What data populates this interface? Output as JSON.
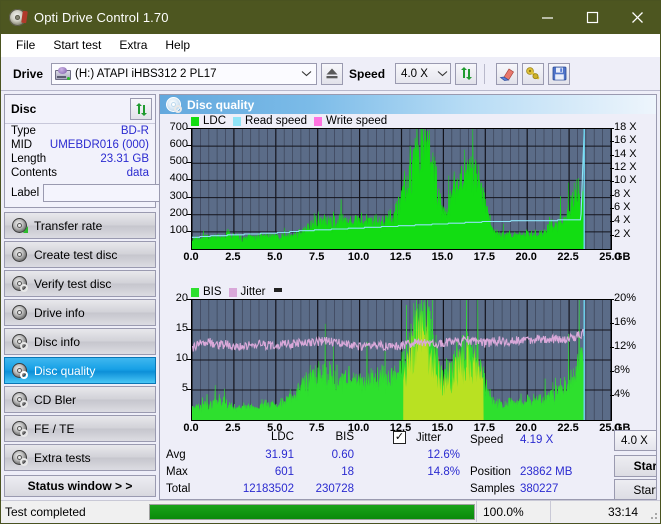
{
  "window": {
    "title": "Opti Drive Control 1.70",
    "icon": "disc-icon",
    "minimize": "minimize-icon",
    "maximize": "maximize-icon",
    "close": "close-icon"
  },
  "menu": {
    "items": [
      "File",
      "Start test",
      "Extra",
      "Help"
    ]
  },
  "toolbar": {
    "drive_label": "Drive",
    "drive_value": "(H:)   ATAPI iHBS312  2 PL17",
    "eject_icon": "eject-icon",
    "speed_label": "Speed",
    "speed_value": "4.0 X",
    "refresh_icon": "refresh-icon",
    "erase_icon": "eraser-icon",
    "bookmark_icon": "keys-icon",
    "save_icon": "floppy-save-icon"
  },
  "disc_panel": {
    "title": "Disc",
    "refresh_icon": "refresh-icon",
    "rows": [
      {
        "key": "Type",
        "value": "BD-R"
      },
      {
        "key": "MID",
        "value": "UMEBDR016 (000)"
      },
      {
        "key": "Length",
        "value": "23.31 GB"
      },
      {
        "key": "Contents",
        "value": "data"
      }
    ],
    "label_key": "Label",
    "label_value": "",
    "label_placeholder": "",
    "disc_button_icon": "disc-icon"
  },
  "nav": {
    "items": [
      {
        "label": "Transfer rate",
        "icon": "disc-arrow-icon",
        "active": false
      },
      {
        "label": "Create test disc",
        "icon": "disc-icon",
        "active": false
      },
      {
        "label": "Verify test disc",
        "icon": "disc-check-icon",
        "active": false
      },
      {
        "label": "Drive info",
        "icon": "drive-icon",
        "active": false
      },
      {
        "label": "Disc info",
        "icon": "disc-info-icon",
        "active": false
      },
      {
        "label": "Disc quality",
        "icon": "disc-quality-icon",
        "active": true
      },
      {
        "label": "CD Bler",
        "icon": "disc-icon",
        "active": false
      },
      {
        "label": "FE / TE",
        "icon": "disc-icon",
        "active": false
      },
      {
        "label": "Extra tests",
        "icon": "disc-icon",
        "active": false
      }
    ],
    "status_window": "Status window > >"
  },
  "panel": {
    "title": "Disc quality",
    "icon": "disc-quality-icon"
  },
  "stats": {
    "col_headers": [
      "LDC",
      "BIS"
    ],
    "row_headers": [
      "Avg",
      "Max",
      "Total"
    ],
    "ldc": {
      "avg": "31.91",
      "max": "601",
      "total": "12183502"
    },
    "bis": {
      "avg": "0.60",
      "max": "18",
      "total": "230728"
    },
    "jitter": {
      "label": "Jitter",
      "checked": true,
      "avg": "12.6%",
      "max": "14.8%"
    },
    "speed_label": "Speed",
    "speed_value": "4.19 X",
    "position_label": "Position",
    "position_value": "23862 MB",
    "samples_label": "Samples",
    "samples_value": "380227",
    "speed_select": "4.0 X",
    "start_full": "Start full",
    "start_part": "Start part"
  },
  "statusbar": {
    "text": "Test completed",
    "percent_label": "100.0%",
    "percent_value": 100,
    "elapsed": "33:14"
  },
  "colors": {
    "titlebar": "#4d5620",
    "plot_bg": "#5b6c88",
    "grid": "#1a1a22",
    "ldc_green": "#12dd12",
    "bis_green": "#2ee02e",
    "jitter_pink": "#d9a8d9",
    "read_speed_cyan": "#8fe4f7",
    "write_speed_magenta": "#ff72e0",
    "accent_blue": "#2b2bd0",
    "progress_green": "#0f9c0f"
  },
  "chart_data": [
    {
      "type": "area",
      "name": "ldc-read-speed-chart",
      "title": "",
      "xlabel": "GB",
      "ylabel": "",
      "xlim": [
        0,
        25
      ],
      "xticks": [
        "0.0",
        "2.5",
        "5.0",
        "7.5",
        "10.0",
        "12.5",
        "15.0",
        "17.5",
        "20.0",
        "22.5",
        "25.0"
      ],
      "xtick_values": [
        0,
        2.5,
        5,
        7.5,
        10,
        12.5,
        15,
        17.5,
        20,
        22.5,
        25
      ],
      "x_unit": "GB",
      "ylim": [
        0,
        700
      ],
      "yticks": [
        100,
        200,
        300,
        400,
        500,
        600,
        700
      ],
      "y2lim": [
        0,
        18
      ],
      "y2ticks": [
        "2 X",
        "4 X",
        "6 X",
        "8 X",
        "10 X",
        "12 X",
        "14 X",
        "16 X",
        "18 X"
      ],
      "y2tick_values": [
        2,
        4,
        6,
        8,
        10,
        12,
        14,
        16,
        18
      ],
      "grid": true,
      "legend": [
        "LDC",
        "Read speed",
        "Write speed"
      ],
      "legend_position": "top-left",
      "data_end_x": 23.4,
      "series": [
        {
          "name": "LDC",
          "kind": "area",
          "color": "#12dd12",
          "x": [
            0.0,
            0.3,
            0.6,
            0.9,
            1.2,
            1.5,
            1.8,
            2.1,
            2.4,
            2.7,
            3.0,
            3.3,
            3.6,
            3.9,
            4.2,
            4.5,
            4.8,
            5.1,
            5.4,
            5.7,
            6.0,
            6.3,
            6.6,
            6.9,
            7.2,
            7.5,
            7.8,
            8.1,
            8.4,
            8.7,
            9.0,
            9.3,
            9.6,
            9.9,
            10.2,
            10.5,
            10.8,
            11.1,
            11.4,
            11.7,
            12.0,
            12.3,
            12.6,
            12.9,
            13.2,
            13.5,
            13.8,
            14.1,
            14.4,
            14.7,
            15.0,
            15.3,
            15.6,
            15.9,
            16.2,
            16.5,
            16.8,
            17.1,
            17.4,
            17.7,
            18.0,
            18.3,
            18.6,
            18.9,
            19.2,
            19.5,
            19.8,
            20.1,
            20.4,
            20.7,
            21.0,
            21.3,
            21.6,
            21.9,
            22.2,
            22.5,
            22.8,
            23.1,
            23.4
          ],
          "y": [
            50,
            62,
            58,
            66,
            60,
            74,
            70,
            85,
            72,
            66,
            60,
            64,
            70,
            66,
            75,
            68,
            72,
            66,
            70,
            64,
            78,
            86,
            96,
            118,
            140,
            155,
            150,
            160,
            152,
            158,
            150,
            156,
            148,
            162,
            150,
            145,
            155,
            150,
            160,
            172,
            185,
            230,
            300,
            400,
            520,
            570,
            600,
            520,
            430,
            300,
            215,
            230,
            300,
            380,
            430,
            455,
            430,
            380,
            300,
            190,
            95,
            80,
            72,
            80,
            76,
            84,
            78,
            90,
            82,
            95,
            88,
            140,
            120,
            160,
            150,
            200,
            280,
            310,
            300
          ]
        },
        {
          "name": "Read speed",
          "kind": "line",
          "color": "#8fe4f7",
          "axis": "right",
          "x": [
            0.0,
            0.8,
            1.6,
            2.4,
            3.2,
            4.0,
            4.8,
            5.6,
            6.4,
            7.2,
            8.0,
            8.8,
            9.6,
            10.4,
            11.2,
            12.0,
            12.8,
            13.6,
            14.4,
            15.2,
            16.0,
            16.8,
            17.6,
            18.4,
            19.2,
            20.0,
            20.8,
            21.6,
            22.4,
            23.2,
            23.4
          ],
          "y": [
            1.7,
            1.9,
            2.0,
            2.1,
            2.2,
            2.3,
            2.4,
            2.5,
            2.7,
            2.8,
            2.9,
            3.0,
            3.1,
            3.2,
            3.3,
            3.4,
            3.5,
            3.6,
            3.7,
            3.8,
            3.9,
            4.0,
            4.1,
            4.15,
            4.2,
            4.2,
            4.25,
            4.3,
            4.35,
            4.4,
            18.0
          ]
        },
        {
          "name": "Write speed",
          "kind": "line",
          "color": "#ff72e0",
          "axis": "right",
          "x": [],
          "y": []
        }
      ]
    },
    {
      "type": "area",
      "name": "bis-jitter-chart",
      "title": "",
      "xlabel": "GB",
      "ylabel": "",
      "xlim": [
        0,
        25
      ],
      "xticks": [
        "0.0",
        "2.5",
        "5.0",
        "7.5",
        "10.0",
        "12.5",
        "15.0",
        "17.5",
        "20.0",
        "22.5",
        "25.0"
      ],
      "xtick_values": [
        0,
        2.5,
        5,
        7.5,
        10,
        12.5,
        15,
        17.5,
        20,
        22.5,
        25
      ],
      "x_unit": "GB",
      "ylim": [
        0,
        20
      ],
      "yticks": [
        5,
        10,
        15,
        20
      ],
      "y2lim": [
        0,
        20
      ],
      "y2ticks": [
        "4%",
        "8%",
        "12%",
        "16%",
        "20%"
      ],
      "y2tick_values": [
        4,
        8,
        12,
        16,
        20
      ],
      "grid": true,
      "legend": [
        "BIS",
        "Jitter"
      ],
      "legend_position": "top-left",
      "data_end_x": 23.4,
      "series": [
        {
          "name": "BIS",
          "kind": "area",
          "color": "#2ee02e",
          "x": [
            0.0,
            0.3,
            0.6,
            0.9,
            1.2,
            1.5,
            1.8,
            2.1,
            2.4,
            2.7,
            3.0,
            3.3,
            3.6,
            3.9,
            4.2,
            4.5,
            4.8,
            5.1,
            5.4,
            5.7,
            6.0,
            6.3,
            6.6,
            6.9,
            7.2,
            7.5,
            7.8,
            8.1,
            8.4,
            8.7,
            9.0,
            9.3,
            9.6,
            9.9,
            10.2,
            10.5,
            10.8,
            11.1,
            11.4,
            11.7,
            12.0,
            12.3,
            12.6,
            12.9,
            13.2,
            13.5,
            13.8,
            14.1,
            14.4,
            14.7,
            15.0,
            15.3,
            15.6,
            15.9,
            16.2,
            16.5,
            16.8,
            17.1,
            17.4,
            17.7,
            18.0,
            18.3,
            18.6,
            18.9,
            19.2,
            19.5,
            19.8,
            20.1,
            20.4,
            20.7,
            21.0,
            21.3,
            21.6,
            21.9,
            22.2,
            22.5,
            22.8,
            23.1,
            23.4
          ],
          "y": [
            2.0,
            2.4,
            2.2,
            2.6,
            2.3,
            4.0,
            3.0,
            2.4,
            2.2,
            2.0,
            2.3,
            2.2,
            2.4,
            2.1,
            2.6,
            2.3,
            2.5,
            2.2,
            3.0,
            3.4,
            4.0,
            4.6,
            5.2,
            6.0,
            6.8,
            7.4,
            7.0,
            7.2,
            6.8,
            7.0,
            6.6,
            6.8,
            6.4,
            6.6,
            6.2,
            6.0,
            6.4,
            6.2,
            6.6,
            7.0,
            7.4,
            8.0,
            9.0,
            11.0,
            15.0,
            16.5,
            17.5,
            15.0,
            12.0,
            9.5,
            7.5,
            8.0,
            9.0,
            10.5,
            11.5,
            12.0,
            11.0,
            9.5,
            7.0,
            4.5,
            3.0,
            2.6,
            2.4,
            2.8,
            2.6,
            3.0,
            2.7,
            3.2,
            2.9,
            3.4,
            3.0,
            4.6,
            4.0,
            5.2,
            5.0,
            6.4,
            8.0,
            9.6,
            10.4
          ]
        },
        {
          "name": "Jitter",
          "kind": "line",
          "color": "#d9a8d9",
          "axis": "right",
          "x": [
            0.0,
            0.5,
            1.0,
            1.5,
            2.0,
            2.5,
            3.0,
            3.5,
            4.0,
            4.5,
            5.0,
            5.5,
            6.0,
            6.5,
            7.0,
            7.5,
            8.0,
            8.5,
            9.0,
            9.5,
            10.0,
            10.5,
            11.0,
            11.5,
            12.0,
            12.5,
            13.0,
            13.5,
            14.0,
            14.5,
            15.0,
            15.5,
            16.0,
            16.5,
            17.0,
            17.5,
            18.0,
            18.5,
            19.0,
            19.5,
            20.0,
            20.5,
            21.0,
            21.5,
            22.0,
            22.5,
            23.0,
            23.4
          ],
          "y": [
            11.8,
            12.7,
            13.1,
            12.4,
            12.6,
            12.2,
            12.5,
            12.3,
            12.6,
            12.4,
            12.5,
            12.6,
            12.7,
            12.8,
            12.9,
            13.0,
            13.1,
            12.9,
            13.0,
            12.6,
            12.3,
            12.2,
            12.5,
            12.3,
            12.1,
            12.4,
            12.7,
            13.0,
            12.8,
            12.6,
            12.9,
            13.1,
            13.0,
            13.3,
            13.0,
            12.8,
            13.0,
            13.2,
            13.1,
            13.3,
            13.2,
            13.4,
            13.3,
            13.5,
            13.4,
            13.6,
            14.0,
            14.6
          ]
        }
      ]
    }
  ]
}
